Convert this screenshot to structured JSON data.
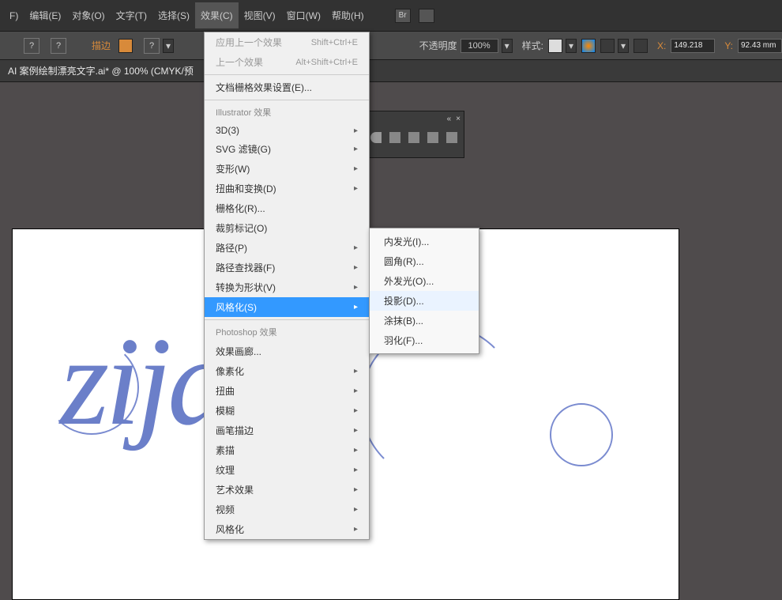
{
  "menubar": {
    "items": [
      "F)",
      "编辑(E)",
      "对象(O)",
      "文字(T)",
      "选择(S)",
      "效果(C)",
      "视图(V)",
      "窗口(W)",
      "帮助(H)"
    ],
    "br_label": "Br"
  },
  "toolbar": {
    "stroke_label": "描边",
    "opacity_label": "不透明度",
    "opacity_value": "100%",
    "style_label": "样式:",
    "x_label": "X:",
    "x_value": "149.218",
    "y_label": "Y:",
    "y_value": "92.43 mm"
  },
  "doctab": {
    "title": "AI 案例绘制漂亮文字.ai* @ 100% (CMYK/预"
  },
  "dropdown": {
    "apply_last": "应用上一个效果",
    "apply_last_key": "Shift+Ctrl+E",
    "last_effect": "上一个效果",
    "last_effect_key": "Alt+Shift+Ctrl+E",
    "doc_raster": "文档栅格效果设置(E)...",
    "section_ai": "Illustrator 效果",
    "items_ai": [
      "3D(3)",
      "SVG 滤镜(G)",
      "变形(W)",
      "扭曲和变换(D)",
      "栅格化(R)...",
      "裁剪标记(O)",
      "路径(P)",
      "路径查找器(F)",
      "转换为形状(V)",
      "风格化(S)"
    ],
    "section_ps": "Photoshop 效果",
    "items_ps": [
      "效果画廊...",
      "像素化",
      "扭曲",
      "模糊",
      "画笔描边",
      "素描",
      "纹理",
      "艺术效果",
      "视频",
      "风格化"
    ]
  },
  "submenu": {
    "items": [
      "内发光(I)...",
      "圆角(R)...",
      "外发光(O)...",
      "投影(D)...",
      "涂抹(B)...",
      "羽化(F)..."
    ]
  },
  "artwork": {
    "text": "zijar"
  },
  "panel": {
    "collapse": "«",
    "close": "×"
  }
}
